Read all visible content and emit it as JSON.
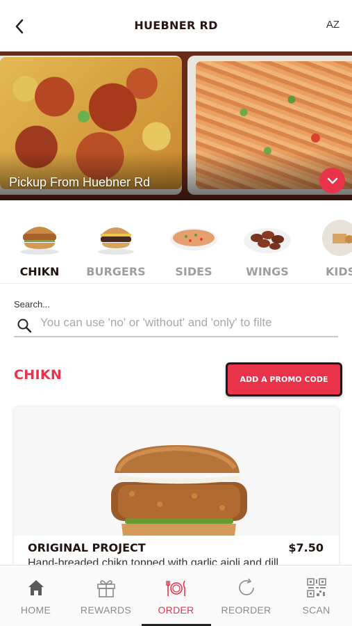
{
  "header": {
    "title": "HUEBNER RD",
    "right_label": "AZ",
    "back_icon": "chevron-left-icon"
  },
  "hero": {
    "caption": "Pickup From Huebner Rd",
    "toggle_icon": "chevron-down-icon"
  },
  "categories": [
    {
      "label": "CHIKN",
      "active": true,
      "icon": "chicken-sandwich-image"
    },
    {
      "label": "BURGERS",
      "active": false,
      "icon": "burger-image"
    },
    {
      "label": "SIDES",
      "active": false,
      "icon": "sides-image"
    },
    {
      "label": "WINGS",
      "active": false,
      "icon": "wings-image"
    },
    {
      "label": "KIDS",
      "active": false,
      "icon": "kids-meal-image"
    }
  ],
  "search": {
    "label": "Search...",
    "placeholder": "You can use 'no' or 'without' and 'only' to filte",
    "value": ""
  },
  "section": {
    "title": "CHIKN",
    "promo_label": "ADD A PROMO CODE"
  },
  "product": {
    "name": "ORIGINAL PROJECT",
    "price": "$7.50",
    "description": "Hand-breaded chikn topped with garlic aioli and dill"
  },
  "bottom_nav": [
    {
      "label": "HOME",
      "icon": "home-icon",
      "active": false
    },
    {
      "label": "REWARDS",
      "icon": "gift-icon",
      "active": false
    },
    {
      "label": "ORDER",
      "icon": "plate-cutlery-icon",
      "active": true
    },
    {
      "label": "REORDER",
      "icon": "refresh-icon",
      "active": false
    },
    {
      "label": "SCAN",
      "icon": "qr-code-icon",
      "active": false
    }
  ],
  "colors": {
    "accent": "#e8334a",
    "dark_text": "#231313",
    "inactive": "#9e9e9e"
  }
}
